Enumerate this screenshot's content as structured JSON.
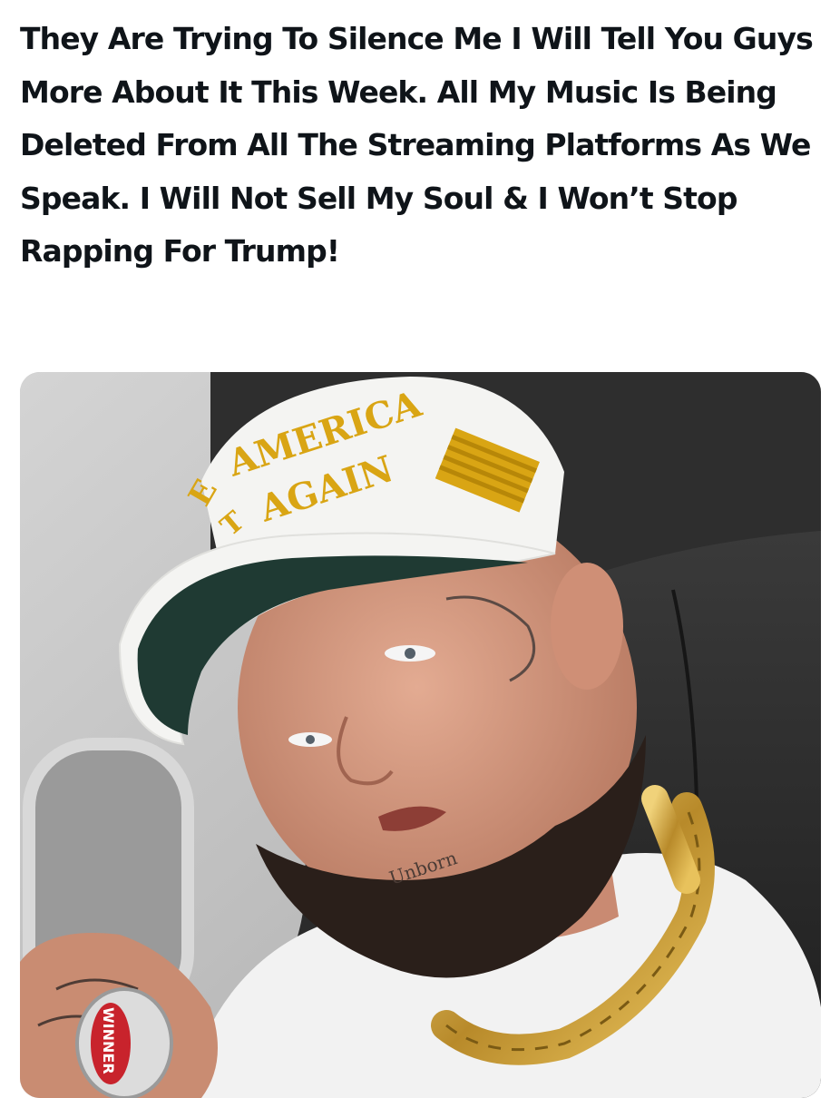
{
  "post": {
    "text": "They Are Trying To Silence Me I Will Tell You Guys More About It This Week. All My Music Is Being Deleted From All The Streaming Platforms As We Speak. I Will Not Sell My Soul & I Won’t Stop Rapping For Trump!"
  },
  "photo": {
    "hat_text_line1": "AMERICA",
    "hat_text_line2": "AGAIN",
    "hat_text_fragment_left": "E",
    "hat_text_fragment_left2": "T",
    "ring_text": "WINNER"
  },
  "colors": {
    "text": "#0f1419",
    "background": "#ffffff",
    "hat": "#f4f4f2",
    "hat_embroidery": "#d9a514",
    "hat_underbrim": "#1f3a33",
    "beard": "#2a1f1a",
    "skin": "#d99a80",
    "shirt": "#f2f2f2",
    "chain": "#c9a13b",
    "seat": "#2b2b2b",
    "cabin_wall": "#c9c9c9"
  }
}
